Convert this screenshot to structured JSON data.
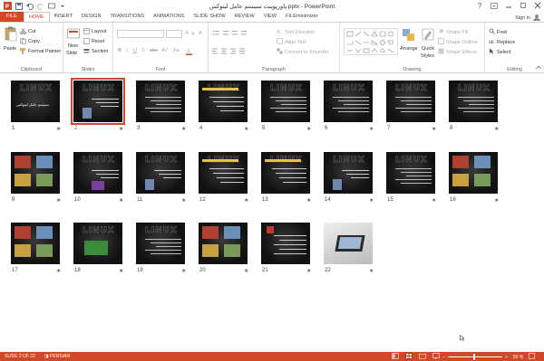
{
  "window": {
    "title": "پاورپوینت سیستم عامل لینوکس.pptx - PowerPoint",
    "controls": [
      "?",
      "minimize",
      "restore",
      "close"
    ]
  },
  "tabs": [
    "FILE",
    "HOME",
    "INSERT",
    "DESIGN",
    "TRANSITIONS",
    "ANIMATIONS",
    "SLIDE SHOW",
    "REVIEW",
    "VIEW",
    "FILEminimizer"
  ],
  "active_tab": "HOME",
  "signin": "Sign in",
  "ribbon": {
    "clipboard": {
      "label": "Clipboard",
      "paste": "Paste",
      "cut": "Cut",
      "copy": "Copy",
      "format_painter": "Format Painter"
    },
    "slides": {
      "label": "Slides",
      "new_slide": "New",
      "new_slide2": "Slide",
      "layout": "Layout",
      "reset": "Reset",
      "section": "Section"
    },
    "font": {
      "label": "Font",
      "bold": "B",
      "italic": "I",
      "underline": "U",
      "shadow": "S",
      "strike": "abc",
      "spacing": "AV",
      "case": "Aa",
      "size_up": "A",
      "size_down": "A",
      "clear": "A"
    },
    "paragraph": {
      "label": "Paragraph",
      "text_direction": "Text Direction",
      "align_text": "Align Text",
      "smartart": "Convert to SmartArt"
    },
    "drawing": {
      "label": "Drawing",
      "arrange": "Arrange",
      "quick_styles": "Quick",
      "quick_styles2": "Styles",
      "shape_fill": "Shape Fill",
      "shape_outline": "Shape Outline",
      "shape_effects": "Shape Effects"
    },
    "editing": {
      "label": "Editing",
      "find": "Find",
      "replace": "Replace",
      "select": "Select"
    }
  },
  "slides": [
    {
      "num": "1",
      "variant": "title",
      "title_text": "سیستم عامل لینوکس"
    },
    {
      "num": "2",
      "variant": "text_pic",
      "selected": true
    },
    {
      "num": "3",
      "variant": "dark_text"
    },
    {
      "num": "4",
      "variant": "yellow_bars"
    },
    {
      "num": "5",
      "variant": "text_only"
    },
    {
      "num": "6",
      "variant": "logo_text"
    },
    {
      "num": "7",
      "variant": "text_only"
    },
    {
      "num": "8",
      "variant": "logo_text"
    },
    {
      "num": "9",
      "variant": "pics_grid"
    },
    {
      "num": "10",
      "variant": "logo_purple"
    },
    {
      "num": "11",
      "variant": "logo_pic"
    },
    {
      "num": "12",
      "variant": "yellow_bars"
    },
    {
      "num": "13",
      "variant": "yellow_bars"
    },
    {
      "num": "14",
      "variant": "logo_pic"
    },
    {
      "num": "15",
      "variant": "logo_text"
    },
    {
      "num": "16",
      "variant": "pics_grid"
    },
    {
      "num": "17",
      "variant": "pics_grid"
    },
    {
      "num": "18",
      "variant": "green_screen"
    },
    {
      "num": "19",
      "variant": "text_only"
    },
    {
      "num": "20",
      "variant": "pics_grid"
    },
    {
      "num": "21",
      "variant": "red_icon"
    },
    {
      "num": "22",
      "variant": "laptop_photo"
    }
  ],
  "statusbar": {
    "slide_info": "SLIDE 2 OF 22",
    "language": "PERSIAN",
    "zoom": "50 %"
  },
  "colors": {
    "accent": "#d24726",
    "thumb_bg": "#141414"
  }
}
